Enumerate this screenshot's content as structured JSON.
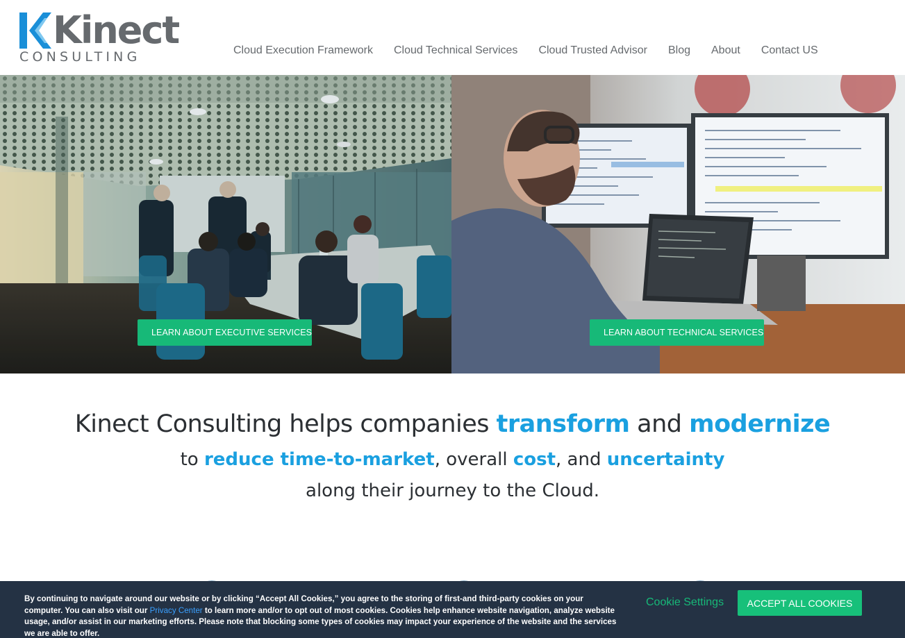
{
  "brand": {
    "name": "Kinect",
    "subtitle": "CONSULTING",
    "logo_color": "#1a8fd8",
    "word_color": "#666a6e"
  },
  "nav": {
    "items": [
      {
        "label": "Cloud Execution Framework"
      },
      {
        "label": "Cloud Technical Services"
      },
      {
        "label": "Cloud Trusted Advisor"
      },
      {
        "label": "Blog"
      },
      {
        "label": "About"
      },
      {
        "label": "Contact US"
      }
    ]
  },
  "hero": {
    "left_cta": "LEARN ABOUT EXECUTIVE SERVICES",
    "right_cta": "LEARN ABOUT TECHNICAL SERVICES",
    "cta_color": "#17b978"
  },
  "tagline": {
    "line1_a": "Kinect Consulting helps companies ",
    "line1_b": "transform",
    "line1_c": " and ",
    "line1_d": "modernize",
    "line2_a": "to ",
    "line2_b": "reduce time-to-market",
    "line2_c": ", overall ",
    "line2_d": "cost",
    "line2_e": ", and ",
    "line2_f": "uncertainty",
    "line3": "along their journey to the Cloud.",
    "highlight_color": "#1aa0e0"
  },
  "cookie": {
    "text_before": "By continuing to navigate around our website or by clicking “Accept All Cookies,” you agree to the storing of first-and third-party cookies on your computer.  You can also visit our ",
    "link": "Privacy Center",
    "text_after": " to learn more and/or to opt out of most cookies.  Cookies help enhance website navigation, analyze website usage, and/or assist in our marketing efforts. Please note that blocking some types of cookies may impact your experience of the website and the services we are able to offer.",
    "settings_label": "Cookie Settings",
    "accept_label": "ACCEPT ALL COOKIES",
    "bar_color": "#243244"
  }
}
